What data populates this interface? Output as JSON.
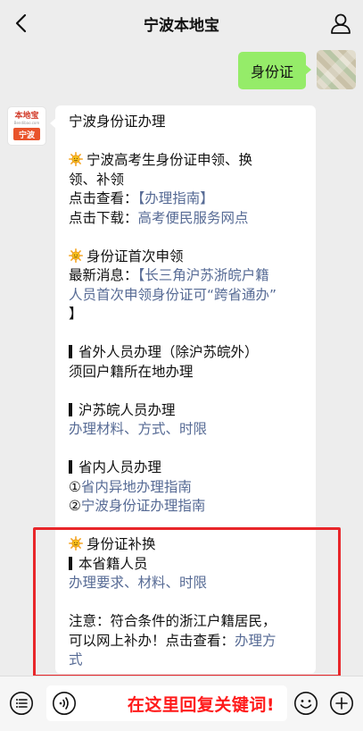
{
  "header": {
    "title": "宁波本地宝",
    "back_icon": "chevron-left-icon",
    "profile_icon": "person-icon"
  },
  "chat": {
    "user_message": "身份证",
    "bot_avatar": {
      "logo_text": "本地宝",
      "logo_subtext": "Bendibao.com",
      "city_label": "宁波"
    },
    "bot_message": {
      "title": "宁波身份证办理",
      "s1_line1": "宁波高考生身份证申领、换",
      "s1_line2": "领、补领",
      "s1_view_prefix": "点击查看：",
      "s1_view_link": "【办理指南】",
      "s1_download_prefix": "点击下载：",
      "s1_download_link": "高考便民服务网点",
      "s2_title": "身份证首次申领",
      "s2_news_prefix": "最新消息：",
      "s2_news_link_line1": "【长三角沪苏浙皖户籍",
      "s2_news_link_line2": "人员首次申领身份证可“跨省通办”",
      "s2_news_close": "】",
      "s3_title": "省外人员办理（除沪苏皖外）",
      "s3_note": "须回户籍所在地办理",
      "s4_title": "沪苏皖人员办理",
      "s4_link": "办理材料、方式、时限",
      "s5_title": "省内人员办理",
      "s5_item1_num": "①",
      "s5_item1_link": "省内异地办理指南",
      "s5_item2_num": "②",
      "s5_item2_link": "宁波身份证办理指南",
      "s6_title": "身份证补换",
      "s6_sub": "本省籍人员",
      "s6_link": "办理要求、材料、时限",
      "note_line1": "注意：符合条件的浙江户籍居民，",
      "note_line2_prefix": "可以网上补办！点击查看：",
      "note_line2_link": "办理方",
      "note_line3_link": "式"
    }
  },
  "input_bar": {
    "hint": "在这里回复关键词!",
    "icons": [
      "menu-list-icon",
      "voice-icon",
      "emoji-icon",
      "plus-icon"
    ]
  },
  "colors": {
    "user_bubble": "#95ec69",
    "link": "#576b95",
    "highlight_box": "#e8262a",
    "hint_text": "#ff1a1a",
    "city_badge": "#e9532b"
  }
}
